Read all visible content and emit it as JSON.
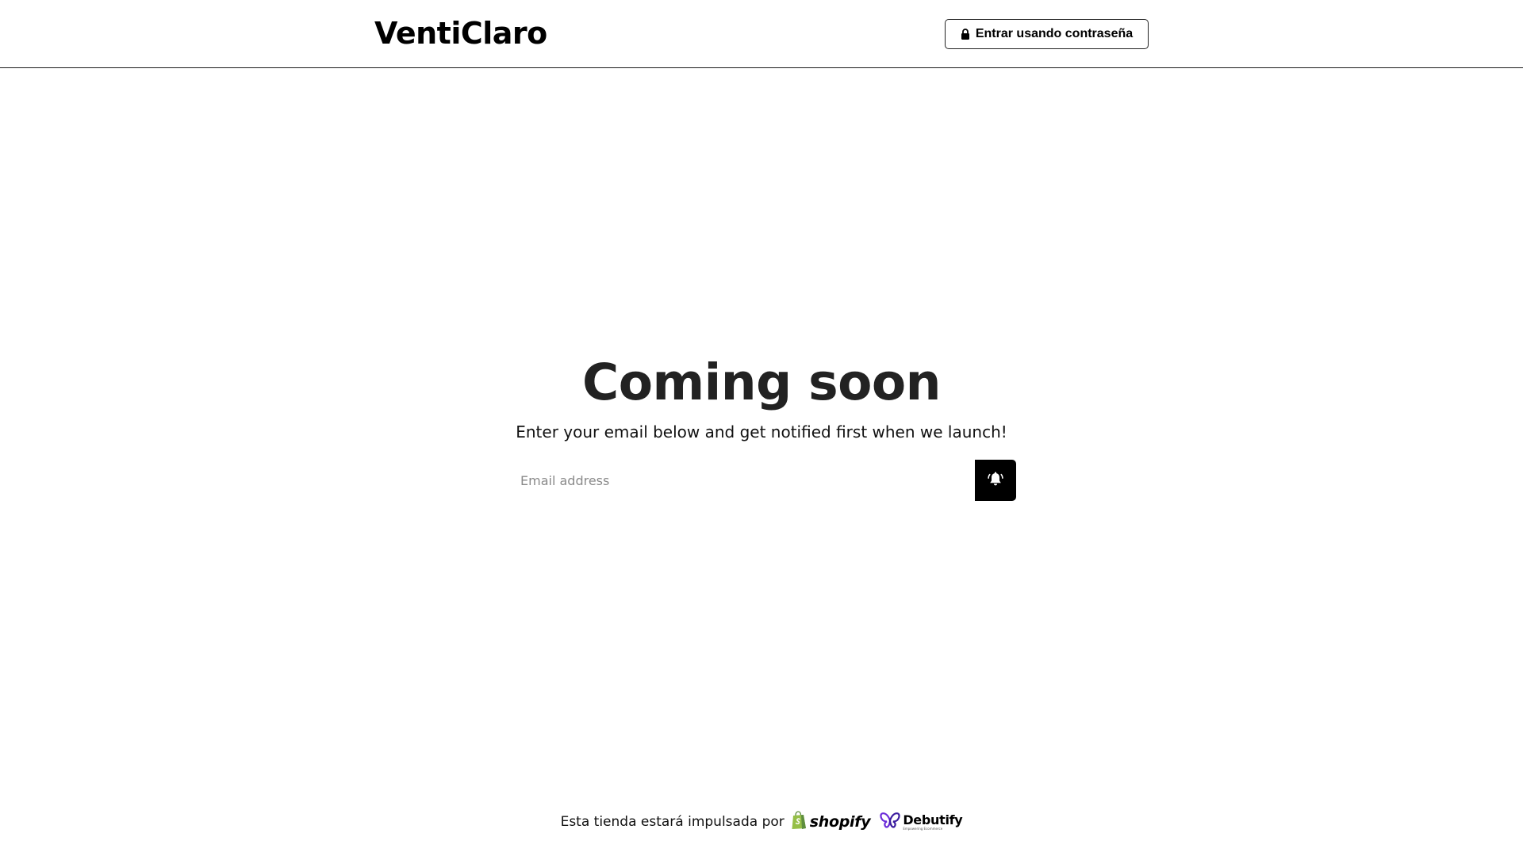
{
  "header": {
    "brand": "VentiClaro",
    "password_button_label": "Entrar usando contraseña",
    "password_button_icon": "lock-icon"
  },
  "hero": {
    "title": "Coming soon",
    "subtitle": "Enter your email below and get notified first when we launch!"
  },
  "signup": {
    "email_placeholder": "Email address",
    "email_value": "",
    "submit_icon": "bell-icon"
  },
  "footer": {
    "powered_by_text": "Esta tienda estará impulsada por",
    "shopify_logo_text": "shopify",
    "debutify_logo_text": "Debutify",
    "debutify_tagline": "Empowering Ecommerce"
  },
  "colors": {
    "background": "#ffffff",
    "text": "#000000",
    "title": "#222222",
    "button_bg": "#000000",
    "shopify_green": "#95bf47",
    "debutify_purple": "#6b2bd9"
  }
}
